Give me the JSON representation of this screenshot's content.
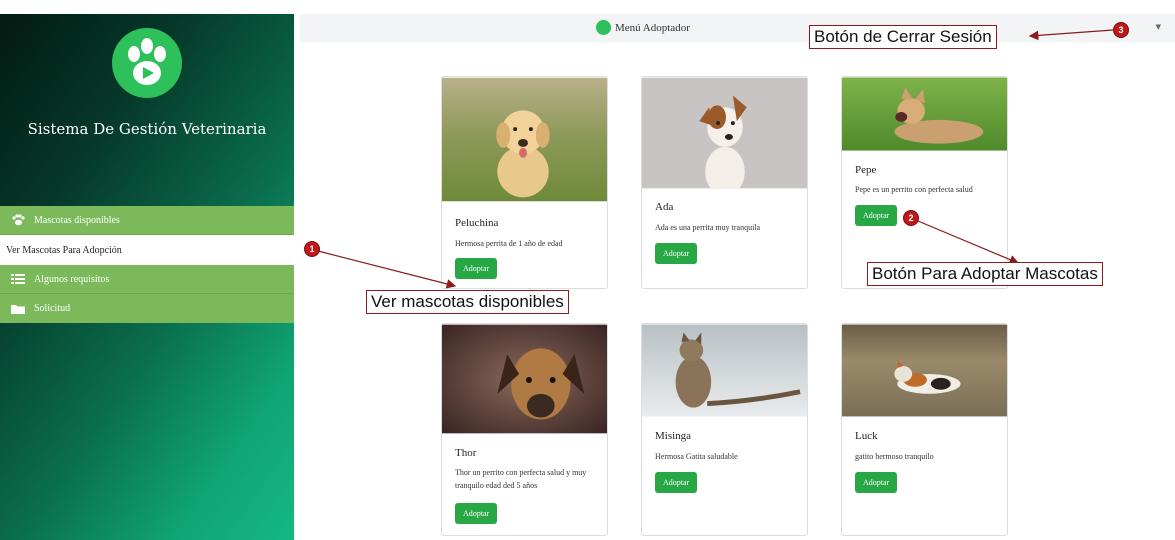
{
  "sidebar": {
    "brand": "Sistema De Gestión Veterinaria",
    "items": [
      {
        "label": "Mascotas disponibles",
        "icon": "paw-icon"
      },
      {
        "label": "Ver Mascotas Para Adopción"
      },
      {
        "label": "Algunos requisitos",
        "icon": "list-icon"
      },
      {
        "label": "Solicitud",
        "icon": "folder-icon"
      }
    ]
  },
  "header": {
    "title": "Menú Adoptador"
  },
  "pets": [
    {
      "name": "Peluchina",
      "description": "Hermosa perrita de 1 año de edad",
      "button": "Adoptar",
      "image": "puppy-golden"
    },
    {
      "name": "Ada",
      "description": "Ada es una perrita muy tranquila",
      "button": "Adoptar",
      "image": "puppy-jackrussell"
    },
    {
      "name": "Pepe",
      "description": "Pepe es un perrito con perfecta salud",
      "button": "Adoptar",
      "image": "dog-yawning"
    },
    {
      "name": "Thor",
      "description": "Thor un perrito con perfecta salud y muy tranquilo edad ded 5 años",
      "button": "Adoptar",
      "image": "dog-brown"
    },
    {
      "name": "Misinga",
      "description": "Hermosa Gatita saludable",
      "button": "Adoptar",
      "image": "cat-tabby"
    },
    {
      "name": "Luck",
      "description": "gatito hermoso tranquilo",
      "button": "Adoptar",
      "image": "cat-calico"
    }
  ],
  "annotations": [
    {
      "number": "1",
      "label": "Ver mascotas disponibles"
    },
    {
      "number": "2",
      "label": "Botón Para Adoptar Mascotas"
    },
    {
      "number": "3",
      "label": "Botón de Cerrar Sesión"
    }
  ],
  "colors": {
    "accent": "#28a745",
    "sidebar_item": "#7cb95a",
    "annotation": "#c0171b"
  }
}
